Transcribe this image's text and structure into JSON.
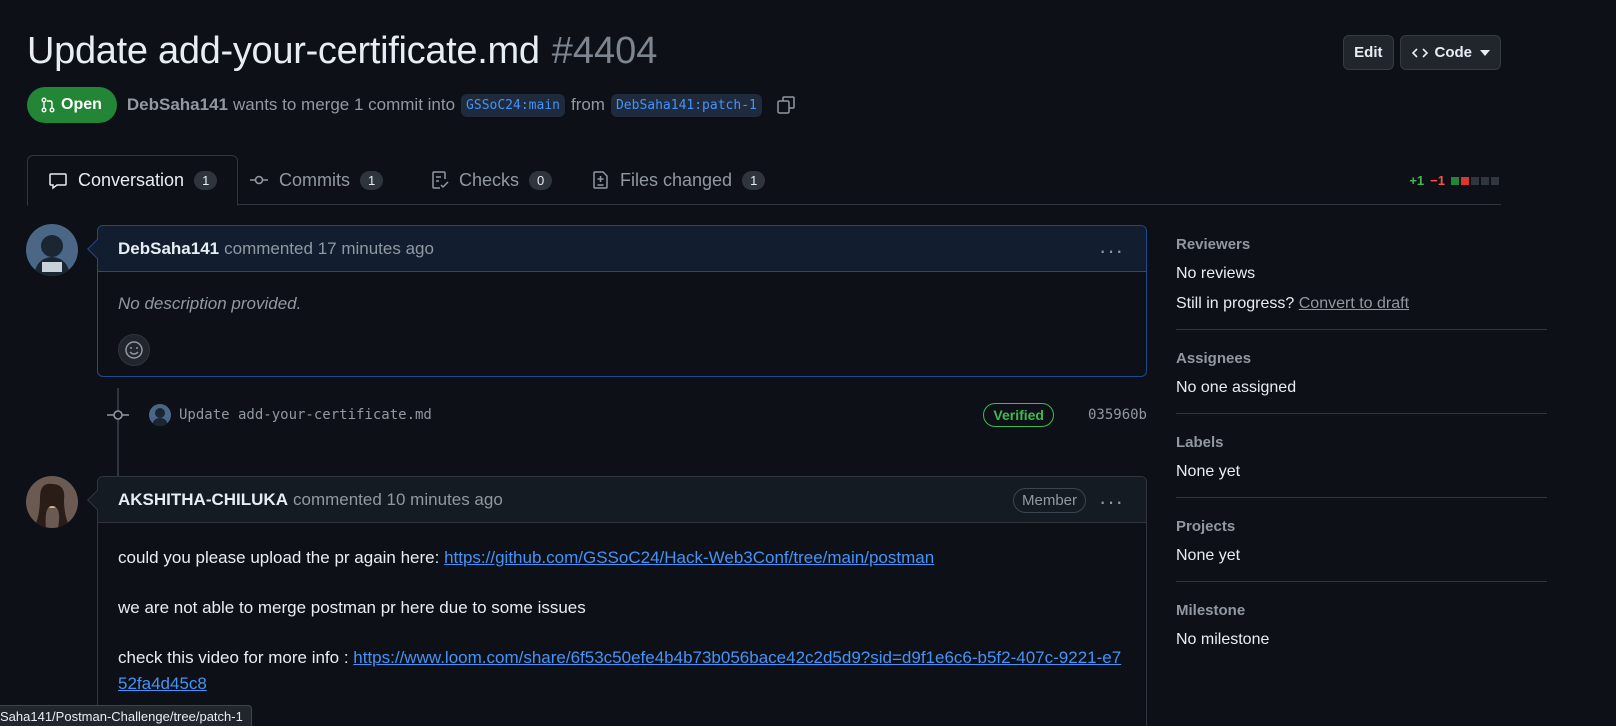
{
  "header": {
    "title": "Update add-your-certificate.md",
    "number": "#4404",
    "edit_label": "Edit",
    "code_label": "Code"
  },
  "meta": {
    "state": "Open",
    "author": "DebSaha141",
    "text": "wants to merge 1 commit into",
    "base_branch": "GSSoC24:main",
    "from_text": "from",
    "head_branch": "DebSaha141:patch-1"
  },
  "tabs": [
    {
      "label": "Conversation",
      "count": "1"
    },
    {
      "label": "Commits",
      "count": "1"
    },
    {
      "label": "Checks",
      "count": "0"
    },
    {
      "label": "Files changed",
      "count": "1"
    }
  ],
  "diffstat": {
    "additions": "+1",
    "deletions": "−1"
  },
  "comments": [
    {
      "author": "DebSaha141",
      "action": "commented",
      "time": "17 minutes ago",
      "body": "No description provided."
    },
    {
      "author": "AKSHITHA-CHILUKA",
      "action": "commented",
      "time": "10 minutes ago",
      "role": "Member",
      "p1_text": "could you please upload the pr again here: ",
      "p1_link": "https://github.com/GSSoC24/Hack-Web3Conf/tree/main/postman",
      "p2_text": "we are not able to merge postman pr here due to some issues",
      "p3_text": "check this video for more info : ",
      "p3_link": "https://www.loom.com/share/6f53c50efe4b4b73b056bace42c2d5d9?sid=d9f1e6c6-b5f2-407c-9221-e752fa4d45c8"
    }
  ],
  "commit": {
    "message": "Update add-your-certificate.md",
    "status": "Verified",
    "sha": "035960b"
  },
  "sidebar": {
    "reviewers_title": "Reviewers",
    "reviewers_value": "No reviews",
    "in_progress_text": "Still in progress?",
    "convert_link": "Convert to draft",
    "assignees_title": "Assignees",
    "assignees_value": "No one assigned",
    "labels_title": "Labels",
    "labels_value": "None yet",
    "projects_title": "Projects",
    "projects_value": "None yet",
    "milestone_title": "Milestone",
    "milestone_value": "No milestone"
  },
  "status_url": "Saha141/Postman-Challenge/tree/patch-1",
  "colors": {
    "background": "#0d1117",
    "open_green": "#238636",
    "link_blue": "#4493f8",
    "verified_green": "#3fb950",
    "deletion_red": "#f85149"
  }
}
